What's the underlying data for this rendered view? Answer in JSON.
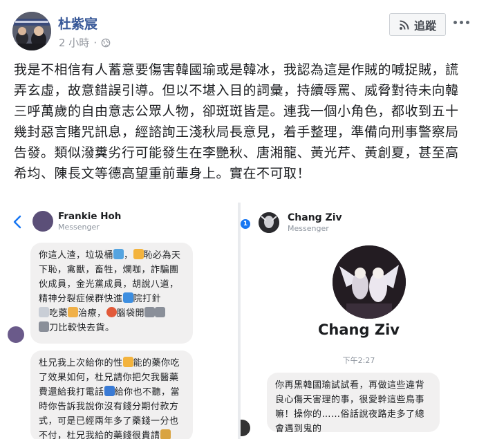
{
  "post": {
    "author": "杜紫宸",
    "time": "2 小時",
    "separator": "·",
    "follow_label": "追蹤",
    "body": "我是不相信有人蓄意要傷害韓國瑜或是韓冰，我認為這是作賊的喊捉賊，謊弄玄虛，故意錯誤引導。但以不堪入目的詞彙，持續辱罵、威脅對待未向韓三呼萬歲的自由意志公眾人物，卻斑斑皆是。連我一個小角色，都收到五十幾封惡言賭咒訊息，經諮詢王淺秋局長意見，着手整理，準備向刑事警察局告發。類似潑糞劣行可能發生在李艷秋、唐湘龍、黃光芹、黃創夏，甚至高希均、陳長文等德高望重前輩身上。實在不可取！"
  },
  "left_screenshot": {
    "name": "Frankie Hoh",
    "subtitle": "Messenger",
    "message_1": {
      "p1": "你這人渣，垃圾桶",
      "p2": "，",
      "p3": "恥必為天下恥，禽獸，畜牲，爛咖，詐騙團伙成員，金光黨成員，胡說八道，精神分裂症候群快進",
      "p4": "院打針",
      "p5": "吃藥",
      "p6": "治療，",
      "p7": "腦袋開",
      "p8": "刀比較快去貨。"
    },
    "message_2": {
      "p1": "杜兄我上次給你的性",
      "p2": "能的藥你吃了效果如何，杜兄請你把欠我醫藥費還給我打電話",
      "p3": "給你也不聽，當時你告訴我說你沒有錢分期付款方式，可是已經兩年多了藥錢一分也不付，杜兄我給的藥錢很貴請"
    }
  },
  "right_screenshot": {
    "badge": "1",
    "name": "Chang Ziv",
    "subtitle": "Messenger",
    "profile_name": "Chang Ziv",
    "timestamp": "下午2:27",
    "message": "你再黑韓國瑜試試看，再做這些違背良心傷天害理的事，很愛幹這些鳥事嘛！操你的……俗話說夜路走多了總會遇到鬼的"
  },
  "colors": {
    "link_blue": "#385898",
    "meta_gray": "#90949c",
    "bubble_bg": "#f1f0f0",
    "divider": "#e9ebee",
    "messenger_blue": "#1877f2"
  }
}
